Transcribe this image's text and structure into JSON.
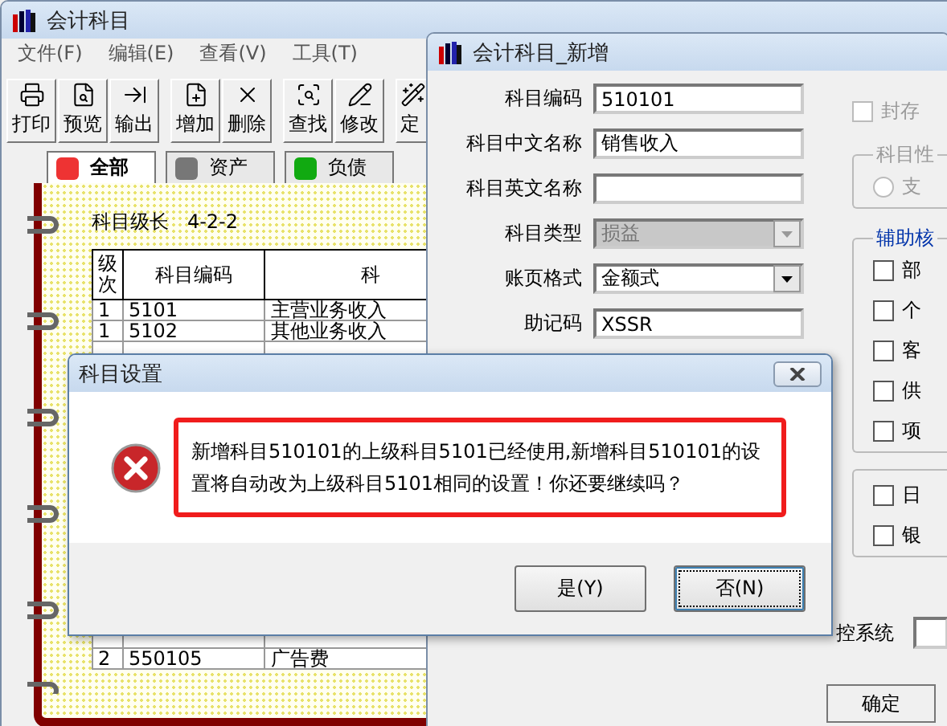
{
  "main_window": {
    "title": "会计科目",
    "menu": [
      "文件(F)",
      "编辑(E)",
      "查看(V)",
      "工具(T)"
    ],
    "toolbar": [
      {
        "label": "打印"
      },
      {
        "label": "预览"
      },
      {
        "label": "输出"
      },
      {
        "label": "增加"
      },
      {
        "label": "删除"
      },
      {
        "label": "查找"
      },
      {
        "label": "修改"
      },
      {
        "label": "定"
      }
    ],
    "tabs": [
      {
        "label": "全部",
        "selected": true
      },
      {
        "label": "资产",
        "selected": false
      },
      {
        "label": "负债",
        "selected": false
      }
    ],
    "level_label": "科目级长",
    "level_value": "4-2-2",
    "table": {
      "columns": [
        "级次",
        "科目编码",
        "科"
      ],
      "rows": [
        [
          "1",
          "5101",
          "主营业务收入"
        ],
        [
          "1",
          "5102",
          "其他业务收入"
        ],
        [
          "2",
          "550105",
          "广告费"
        ]
      ]
    }
  },
  "add_window": {
    "title": "会计科目_新增",
    "fields": [
      {
        "label": "科目编码",
        "value": "510101",
        "kind": "text",
        "disabled": false
      },
      {
        "label": "科目中文名称",
        "value": "销售收入",
        "kind": "text",
        "disabled": false
      },
      {
        "label": "科目英文名称",
        "kind": "text",
        "disabled": false
      },
      {
        "label": "科目类型",
        "value": "损益",
        "kind": "select",
        "disabled": true
      },
      {
        "label": "账页格式",
        "value": "金额式",
        "kind": "select",
        "disabled": false
      },
      {
        "label": "助记码",
        "value": "XSSR",
        "kind": "text",
        "disabled": false
      }
    ],
    "sealed": {
      "label": "封存",
      "checked": false,
      "disabled": true
    },
    "nature_group": {
      "title": "科目性",
      "options": [
        {
          "label": "支",
          "selected": false,
          "disabled": true
        }
      ]
    },
    "aux_group": {
      "title": "辅助核",
      "items": [
        {
          "label": "部",
          "checked": false
        },
        {
          "label": "个",
          "checked": false
        },
        {
          "label": "客",
          "checked": false
        },
        {
          "label": "供",
          "checked": false
        },
        {
          "label": "项",
          "checked": false
        }
      ]
    },
    "book_group": {
      "items": [
        {
          "label": "日",
          "checked": false
        },
        {
          "label": "银",
          "checked": false
        }
      ]
    },
    "control_label": "控系统",
    "ok_button": "确定"
  },
  "dialog": {
    "title": "科目设置",
    "message": "新增科目510101的上级科目5101已经使用,新增科目510101的设置将自动改为上级科目5101相同的设置！你还要继续吗？",
    "buttons": [
      {
        "label": "是(Y)",
        "focused": false
      },
      {
        "label": "否(N)",
        "focused": true
      }
    ]
  }
}
